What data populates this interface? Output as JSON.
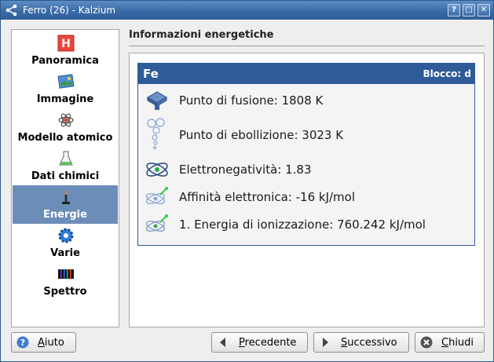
{
  "window": {
    "title": "Ferro (26) - Kalzium",
    "buttons": {
      "help": "?",
      "maximize": "□",
      "close": "✕"
    }
  },
  "sidebar": {
    "items": [
      {
        "label": "Panoramica",
        "icon": "hydrogen-tile-icon",
        "active": false
      },
      {
        "label": "Immagine",
        "icon": "image-icon",
        "active": false
      },
      {
        "label": "Modello atomico",
        "icon": "atom-model-icon",
        "active": false
      },
      {
        "label": "Dati chimici",
        "icon": "flask-icon",
        "active": false
      },
      {
        "label": "Energie",
        "icon": "bunsen-burner-icon",
        "active": true
      },
      {
        "label": "Varie",
        "icon": "gear-icon",
        "active": false
      },
      {
        "label": "Spettro",
        "icon": "spectrum-icon",
        "active": false
      }
    ]
  },
  "main": {
    "heading": "Informazioni energetiche",
    "card": {
      "symbol": "Fe",
      "block": "Blocco: d",
      "rows": [
        {
          "text": "Punto di fusione: 1808 K",
          "icon": "melting-point-icon"
        },
        {
          "text": "Punto di ebollizione: 3023 K",
          "icon": "boiling-bubbles-icon"
        },
        {
          "text": "Elettronegatività: 1.83",
          "icon": "electronegativity-atom-icon"
        },
        {
          "text": "Affinità elettronica: -16 kJ/mol",
          "icon": "electron-affinity-icon"
        },
        {
          "text": "1. Energia di ionizzazione: 760.242 kJ/mol",
          "icon": "ionization-icon"
        }
      ]
    }
  },
  "footer": {
    "help": {
      "prefix": "",
      "accel": "A",
      "rest": "iuto"
    },
    "previous": {
      "accel": "P",
      "rest": "recedente"
    },
    "next": {
      "accel": "S",
      "rest": "uccessivo"
    },
    "close": {
      "accel": "C",
      "rest": "hiudi"
    }
  },
  "colors": {
    "titlebar": "#3b6ba7",
    "active_item": "#6c8db8",
    "card_header": "#2f5b98"
  }
}
